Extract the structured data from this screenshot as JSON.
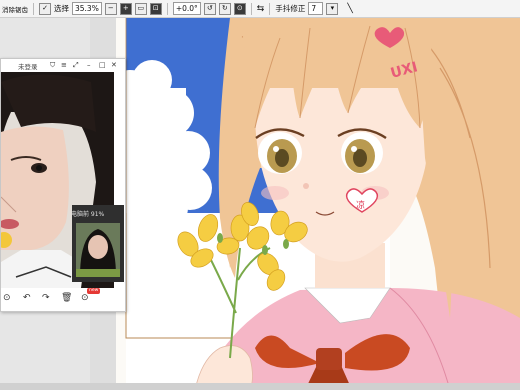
{
  "toolbar": {
    "smoothing_label": "消除锯齿",
    "mode_label": "选择",
    "zoom_value": "35.3%",
    "angle_value": "+0.0°",
    "stabilizer_label": "手抖修正",
    "stabilizer_value": "7"
  },
  "camera_window": {
    "title": "未登录",
    "pip_label": "电脑前 91%",
    "new_badge": "new"
  },
  "colors": {
    "sky": "#3f6fd1",
    "hair": "#f0c596",
    "blazer": "#f5b6c6",
    "ribbon": "#c94a22",
    "flower": "#f5cd42"
  }
}
